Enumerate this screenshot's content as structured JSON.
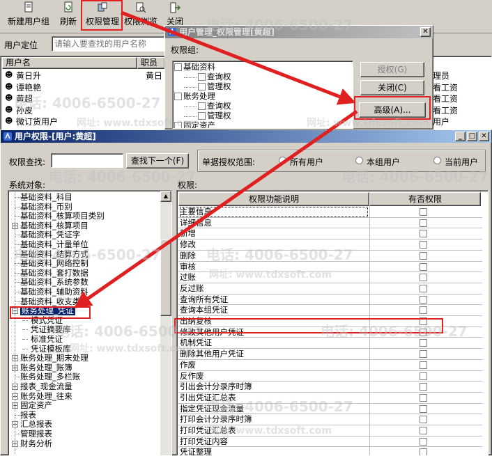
{
  "toolbar": {
    "items": [
      {
        "label": "新建用户组",
        "icon": "new-group-icon"
      },
      {
        "label": "刷新",
        "icon": "refresh-icon"
      },
      {
        "label": "权限管理",
        "icon": "permission-icon"
      },
      {
        "label": "权限浏览",
        "icon": "browse-icon"
      },
      {
        "label": "关闭",
        "icon": "exit-icon"
      }
    ]
  },
  "user_locate": {
    "label": "用户定位",
    "placeholder": "请输入要查找的用户名称"
  },
  "user_list": {
    "headers": [
      "用户名",
      "职员"
    ],
    "rows": [
      {
        "name": "黄日升",
        "staff": "黄日"
      },
      {
        "name": "谭艳艳",
        "staff": ""
      },
      {
        "name": "黄超",
        "staff": ""
      },
      {
        "name": "孙皮",
        "staff": ""
      },
      {
        "name": "微订货用户",
        "staff": ""
      }
    ],
    "right_col": [
      "理员",
      "看工资",
      "看工资",
      "看工资",
      "用户"
    ]
  },
  "perm_dialog": {
    "title": "用户管理_权限管理[黄超]",
    "group_label": "权限组:",
    "tree": [
      {
        "label": "基础资料",
        "level": 0
      },
      {
        "label": "查询权",
        "level": 1
      },
      {
        "label": "管理权",
        "level": 1
      },
      {
        "label": "账务处理",
        "level": 0
      },
      {
        "label": "查询权",
        "level": 1
      },
      {
        "label": "管理权",
        "level": 1
      },
      {
        "label": "固定资产",
        "level": 0
      }
    ],
    "buttons": {
      "grant": "授权(G)",
      "close": "关闭(C)",
      "advanced": "高级(A)..."
    }
  },
  "rights_window": {
    "title": "用户权限-[用户:黄超]",
    "search_label": "权限查找:",
    "find_next": "查找下一个(F)",
    "scope_label": "单据授权范围:",
    "scope_options": [
      "所有用户",
      "本组用户",
      "当前用户"
    ],
    "system_objects_label": "系统对象:",
    "rights_label": "权限:",
    "col_desc": "权限功能说明",
    "col_has": "有否权限",
    "tree": [
      {
        "label": "基础资料_科目",
        "plus": false,
        "level": 1
      },
      {
        "label": "基础资料_币别",
        "plus": false,
        "level": 1
      },
      {
        "label": "基础资料_核算项目类别",
        "plus": false,
        "level": 1
      },
      {
        "label": "基础资料_核算项目",
        "plus": true,
        "level": 1
      },
      {
        "label": "基础资料_凭证字",
        "plus": false,
        "level": 1
      },
      {
        "label": "基础资料_计量单位",
        "plus": false,
        "level": 1
      },
      {
        "label": "基础资料_结算方式",
        "plus": false,
        "level": 1
      },
      {
        "label": "基础资料_网络控制",
        "plus": false,
        "level": 1
      },
      {
        "label": "基础资料_套打数据",
        "plus": false,
        "level": 1
      },
      {
        "label": "基础资料_系统参数",
        "plus": false,
        "level": 1
      },
      {
        "label": "基础资料_辅助资料",
        "plus": false,
        "level": 1
      },
      {
        "label": "基础资料_收支类别",
        "plus": false,
        "level": 1
      },
      {
        "label": "账务处理_凭证",
        "plus": "minus",
        "level": 0,
        "selected": true
      },
      {
        "label": "模式凭证",
        "plus": false,
        "level": 2
      },
      {
        "label": "凭证摘要库",
        "plus": false,
        "level": 2
      },
      {
        "label": "标准凭证",
        "plus": false,
        "level": 2
      },
      {
        "label": "凭证模板库",
        "plus": false,
        "level": 2
      },
      {
        "label": "账务处理_期末处理",
        "plus": true,
        "level": 0
      },
      {
        "label": "账务处理_账簿",
        "plus": true,
        "level": 0
      },
      {
        "label": "账务处理_多栏账",
        "plus": false,
        "level": 1
      },
      {
        "label": "报表_现金流量",
        "plus": true,
        "level": 0
      },
      {
        "label": "账务处理_往来",
        "plus": true,
        "level": 0
      },
      {
        "label": "固定资产",
        "plus": true,
        "level": 0
      },
      {
        "label": "报表",
        "plus": false,
        "level": 1
      },
      {
        "label": "汇总报表",
        "plus": true,
        "level": 0
      },
      {
        "label": "管理报表",
        "plus": false,
        "level": 1
      },
      {
        "label": "财务分析",
        "plus": true,
        "level": 0
      }
    ],
    "permissions": [
      "主要信息",
      "详细信息",
      "新增",
      "修改",
      "删除",
      "审核",
      "过账",
      "反过账",
      "查询所有凭证",
      "查询本组凭证",
      "出纳复核",
      "修改其他用户凭证",
      "机制凭证",
      "删除其他用户凭证",
      "作废",
      "反作废",
      "引出会计分录序时簿",
      "引出凭证汇总表",
      "指定凭证现金流量",
      "打印会计分录序时簿",
      "打印凭证汇总表",
      "打印凭证内容",
      "凭证整理"
    ]
  },
  "watermark": {
    "phone": "电话: 4006-6500-27",
    "site": "网址: www.tdxsoft.com"
  },
  "colors": {
    "highlight": "#e02020",
    "titlebar": "#0a246a",
    "select": "#0a246a"
  }
}
